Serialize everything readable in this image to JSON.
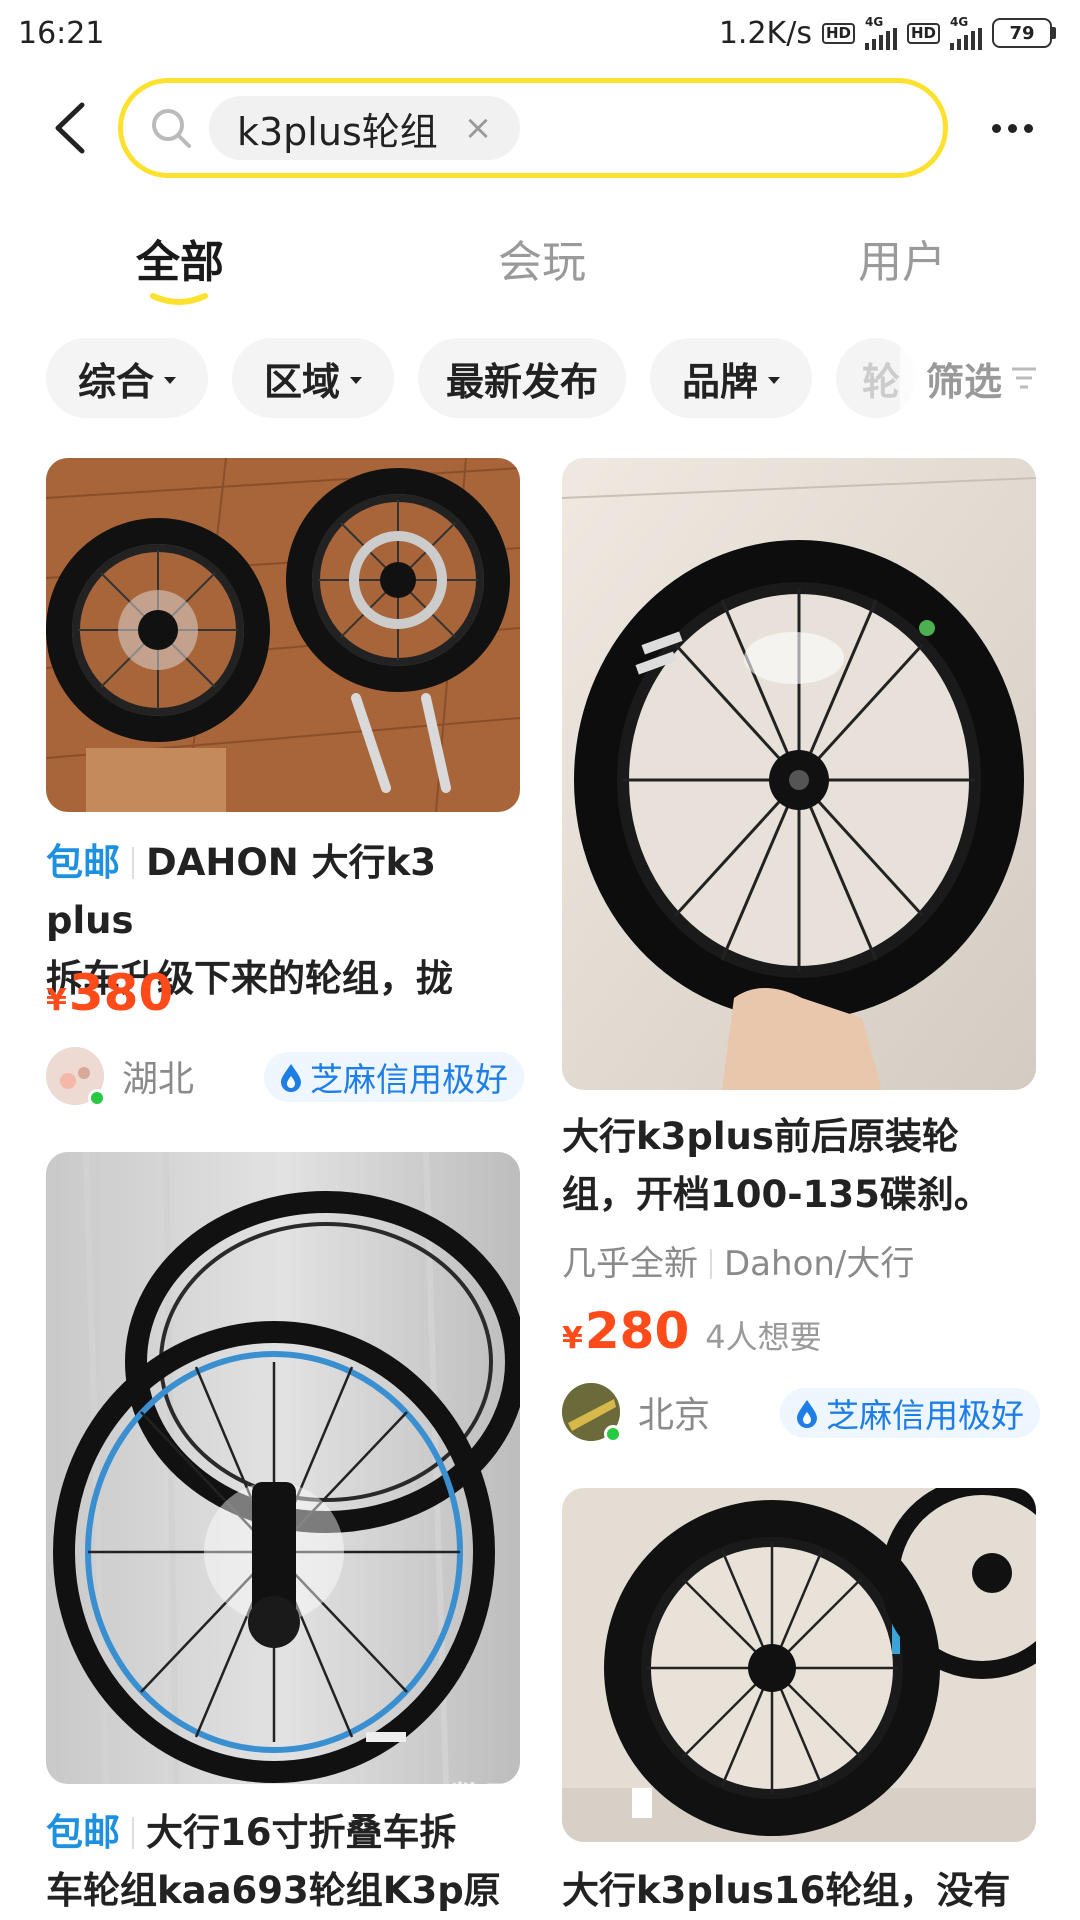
{
  "status_bar": {
    "time": "16:21",
    "net_speed": "1.2K/s",
    "hd1": "HD",
    "hd2": "HD",
    "net1": "4G",
    "net2": "4G",
    "battery": "79"
  },
  "header": {
    "search_query": "k3plus轮组",
    "clear": "×"
  },
  "tabs": [
    {
      "label": "全部",
      "active": true
    },
    {
      "label": "会玩",
      "active": false
    },
    {
      "label": "用户",
      "active": false
    }
  ],
  "filters": [
    {
      "label": "综合",
      "has_caret": true
    },
    {
      "label": "区域",
      "has_caret": true
    },
    {
      "label": "最新发布",
      "has_caret": false
    },
    {
      "label": "品牌",
      "has_caret": true
    },
    {
      "label": "轮",
      "has_caret": false
    },
    {
      "label": "筛选",
      "has_caret": false
    }
  ],
  "items": [
    {
      "badge": "包邮",
      "title_line1": "DAHON 大行k3 plus",
      "title_line2": "拆车升级下来的轮组，拢",
      "currency": "¥",
      "price": "380",
      "location": "湖北",
      "credit": "芝麻信用极好"
    },
    {
      "title_line1": "大行k3plus前后原装轮",
      "title_line2": "组，开档100-135碟刹。",
      "tag1": "几乎全新",
      "tag2": "Dahon/大行",
      "currency": "¥",
      "price": "280",
      "want": "4人想要",
      "location": "北京",
      "credit": "芝麻信用极好"
    },
    {
      "badge": "包邮",
      "title_line1": "大行16寸折叠车拆",
      "title_line2": "车轮组kaa693轮组K3p原"
    },
    {
      "title_line1": "大行k3plus16轮组，没有"
    }
  ],
  "watermark": {
    "text": "数码之家",
    "sub": "MYDIGIT.NET"
  },
  "colors": {
    "accent_yellow": "#fde12f",
    "price_red": "#ff4a1a",
    "link_blue": "#1e90e0"
  }
}
